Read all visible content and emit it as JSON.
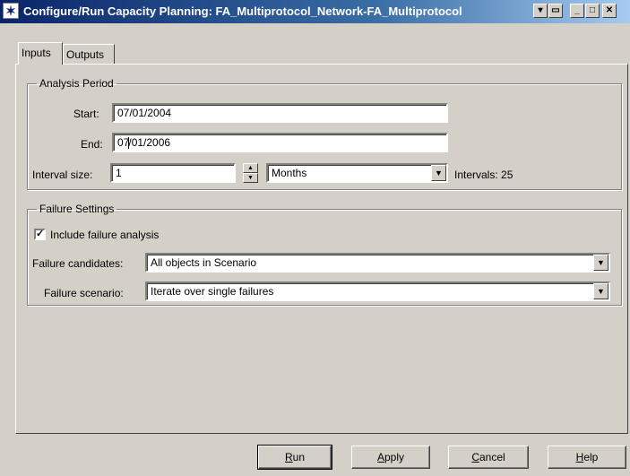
{
  "window": {
    "title": "Configure/Run Capacity Planning: FA_Multiprotocol_Network-FA_Multiprotocol",
    "app_icon": "star-icon"
  },
  "tabs": [
    {
      "label": "Inputs",
      "active": true
    },
    {
      "label": "Outputs",
      "active": false
    }
  ],
  "analysis_period": {
    "legend": "Analysis Period",
    "start_label": "Start:",
    "start_value": "07/01/2004",
    "end_label": "End:",
    "end_value_before_caret": "07",
    "end_value_after_caret": "/01/2006",
    "interval_label": "Interval size:",
    "interval_value": "1",
    "interval_unit": "Months",
    "intervals_text": "Intervals: 25"
  },
  "failure_settings": {
    "legend": "Failure Settings",
    "include_label": "Include failure analysis",
    "include_checked": true,
    "candidates_label": "Failure candidates:",
    "candidates_value": "All objects in Scenario",
    "scenario_label": "Failure scenario:",
    "scenario_value": "Iterate over single failures"
  },
  "buttons": {
    "run": {
      "first": "R",
      "rest": "un"
    },
    "apply": {
      "first": "A",
      "rest": "pply"
    },
    "cancel": {
      "first": "C",
      "rest": "ancel"
    },
    "help": {
      "first": "H",
      "rest": "elp"
    }
  }
}
